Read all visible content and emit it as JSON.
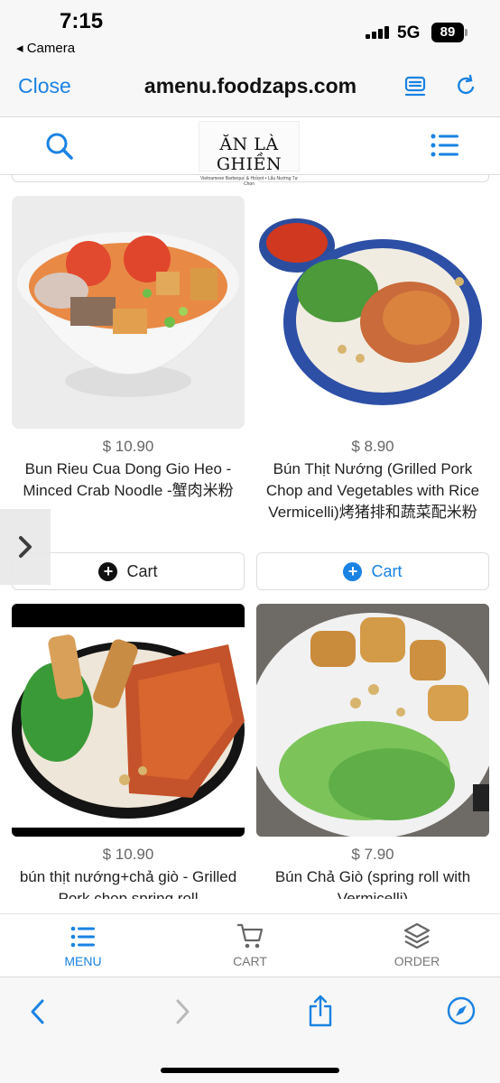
{
  "status_bar": {
    "time": "7:15",
    "back_label": "◂ Camera",
    "network": "5G",
    "battery": "89"
  },
  "browser": {
    "close_label": "Close",
    "url": "amenu.foodzaps.com"
  },
  "site": {
    "logo_text": "ĂN LÀ GHIỀN",
    "logo_subtext": "Vietnamese Barbeque & Hotpot • Lẩu Nướng Tự Chọn"
  },
  "colors": {
    "accent": "#1a82e2",
    "broth": "#e88a45"
  },
  "items": [
    {
      "price": "$ 10.90",
      "name": "Bun Rieu Cua Dong Gio Heo - Minced Crab Noodle -蟹肉米粉",
      "cart_label": "Cart"
    },
    {
      "price": "$ 8.90",
      "name": "Bún Thịt Nướng (Grilled Pork Chop and Vegetables with Rice Vermicelli)烤猪排和蔬菜配米粉",
      "cart_label": "Cart"
    },
    {
      "price": "$ 10.90",
      "name": "bún thịt nướng+chả giò - Grilled Pork chop spring roll"
    },
    {
      "price": "$ 7.90",
      "name": "Bún Chả Giò (spring roll with Vermicelli)"
    }
  ],
  "bottom_nav": [
    {
      "label": "MENU"
    },
    {
      "label": "CART"
    },
    {
      "label": "ORDER"
    }
  ]
}
